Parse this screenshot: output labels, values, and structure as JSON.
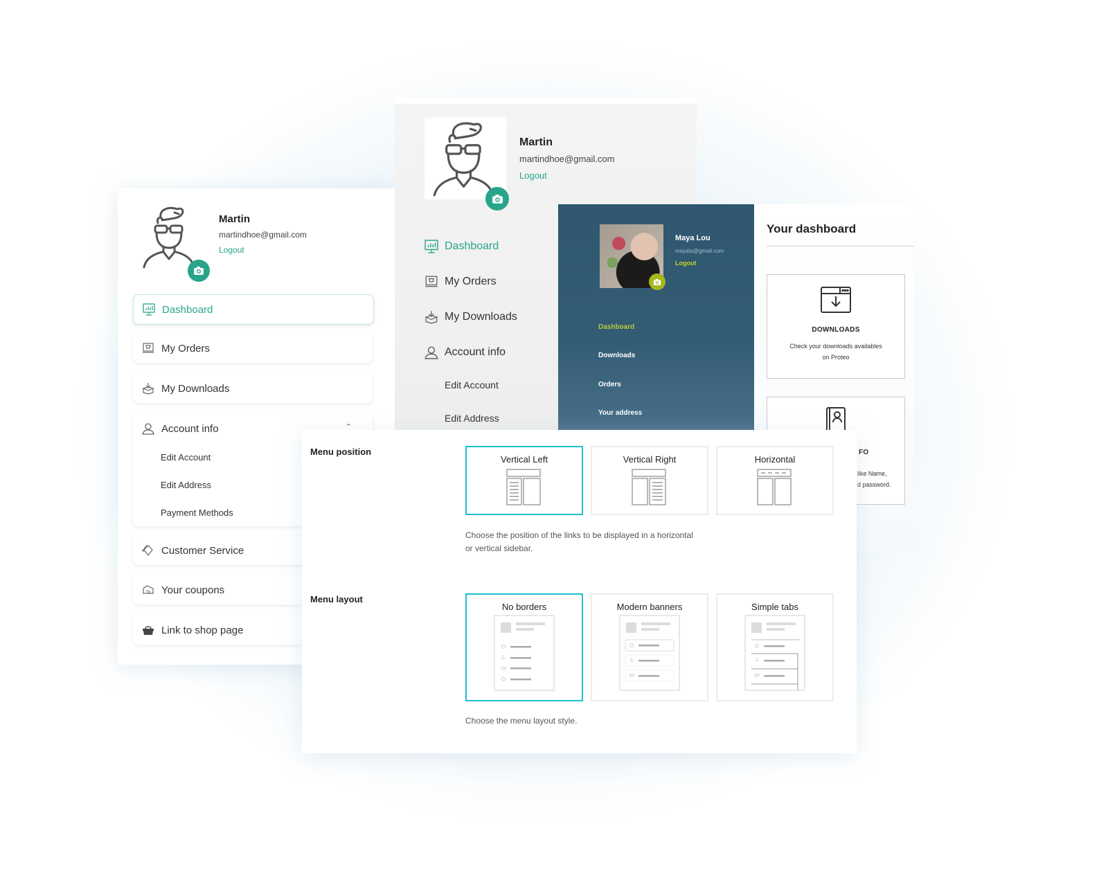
{
  "colors": {
    "accent_green": "#27a58a",
    "dark_panel": "#2f5770",
    "lime_accent": "#b4cb3a",
    "selected_border": "#1ebfd0"
  },
  "panel_boxed": {
    "user": {
      "name": "Martin",
      "email": "martindhoe@gmail.com",
      "logout": "Logout"
    },
    "menu": [
      {
        "label": "Dashboard",
        "icon": "dashboard-icon",
        "active": true
      },
      {
        "label": "My Orders",
        "icon": "orders-icon"
      },
      {
        "label": "My Downloads",
        "icon": "downloads-icon"
      },
      {
        "label": "Account info",
        "icon": "user-icon",
        "expanded": true,
        "children": [
          "Edit Account",
          "Edit Address",
          "Payment Methods"
        ]
      },
      {
        "label": "Customer Service",
        "icon": "headset-icon"
      },
      {
        "label": "Your coupons",
        "icon": "coupon-icon"
      },
      {
        "label": "Link to shop page",
        "icon": "basket-icon"
      }
    ]
  },
  "panel_plain": {
    "user": {
      "name": "Martin",
      "email": "martindhoe@gmail.com",
      "logout": "Logout"
    },
    "menu": [
      {
        "label": "Dashboard",
        "icon": "dashboard-icon",
        "active": true
      },
      {
        "label": "My Orders",
        "icon": "orders-icon"
      },
      {
        "label": "My Downloads",
        "icon": "downloads-icon"
      },
      {
        "label": "Account info",
        "icon": "user-icon"
      }
    ],
    "submenu": [
      "Edit Account",
      "Edit Address"
    ]
  },
  "panel_dark": {
    "user": {
      "name": "Maya Lou",
      "email": "mayalu@gmail.com",
      "logout": "Logout"
    },
    "menu": [
      "Dashboard",
      "Downloads",
      "Orders",
      "Your address"
    ]
  },
  "panel_dashboard": {
    "title": "Your dashboard",
    "cards": [
      {
        "title": "DOWNLOADS",
        "desc_line1": "Check your downloads availables",
        "desc_line2": "on Proteo",
        "icon": "download-window-icon"
      },
      {
        "title_partial": "FO",
        "desc_partial_1": "like Name,",
        "desc_partial_2": "d password.",
        "icon": "contact-book-icon"
      }
    ]
  },
  "settings": {
    "menu_position": {
      "label": "Menu position",
      "options": [
        {
          "label": "Vertical Left",
          "selected": true
        },
        {
          "label": "Vertical Right",
          "selected": false
        },
        {
          "label": "Horizontal",
          "selected": false
        }
      ],
      "desc_line1": "Choose the position of the links to be displayed in a horizontal",
      "desc_line2": "or vertical sidebar."
    },
    "menu_layout": {
      "label": "Menu layout",
      "options": [
        {
          "label": "No borders",
          "selected": true
        },
        {
          "label": "Modern banners",
          "selected": false
        },
        {
          "label": "Simple tabs",
          "selected": false
        }
      ],
      "desc": "Choose the menu layout style."
    }
  }
}
